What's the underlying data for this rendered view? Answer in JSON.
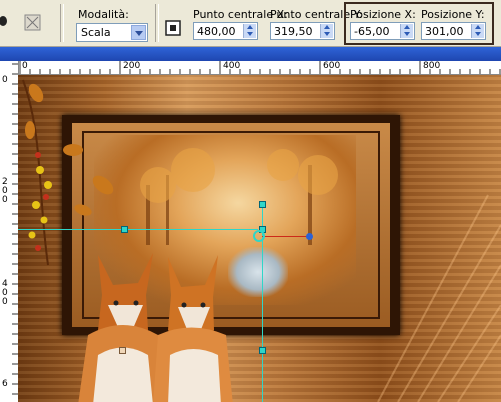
{
  "toolbar": {
    "modalita_label": "Modalità:",
    "modalita_value": "Scala",
    "centro_x_label": "Punto centrale X:",
    "centro_x_value": "480,00",
    "centro_y_label": "Punto centrale Y:",
    "centro_y_value": "319,50",
    "pos_x_label": "Posizione X:",
    "pos_x_value": "-65,00",
    "pos_y_label": "Posizione Y:",
    "pos_y_value": "301,00"
  },
  "hruler": {
    "ticks": [
      "0",
      "200",
      "400",
      "600",
      "800"
    ]
  },
  "vruler": {
    "ticks": [
      "0",
      "2",
      "0",
      "0",
      "4",
      "0",
      "0",
      "6"
    ]
  },
  "accent": {
    "guide": "#2fd6c8",
    "highlight_border": "#3b2a1f",
    "titlebar": "#2f64d7"
  }
}
